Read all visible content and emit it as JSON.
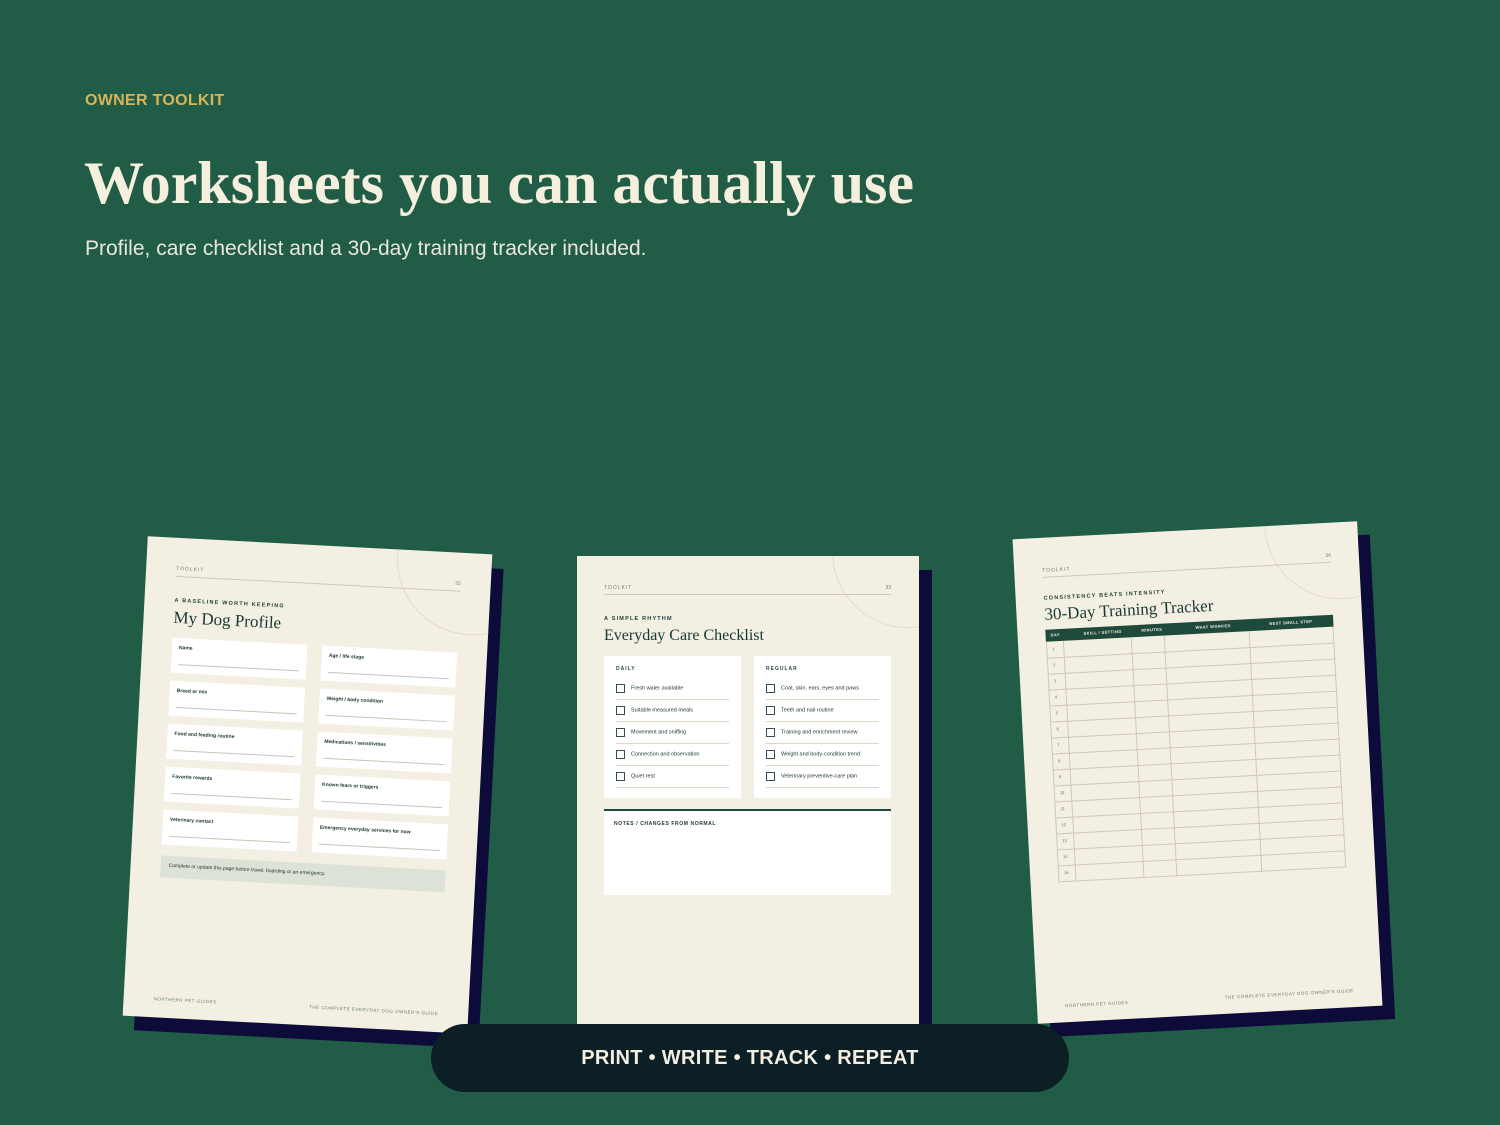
{
  "header": {
    "eyebrow": "OWNER TOOLKIT",
    "title": "Worksheets you can actually use",
    "subtitle": "Profile, care checklist and a 30-day training tracker included."
  },
  "profile_page": {
    "toolkit": "TOOLKIT",
    "page_number": "32",
    "kicker": "A BASELINE WORTH KEEPING",
    "title": "My Dog Profile",
    "fields": [
      "Name",
      "Age / life stage",
      "Breed or mix",
      "Weight / body condition",
      "Food and feeding routine",
      "Medications / sensitivities",
      "Favorite rewards",
      "Known fears or triggers",
      "Veterinary contact",
      "Emergency everyday services for now"
    ],
    "note": "Complete or update this page before travel, boarding or an emergency.",
    "footer_left": "NORTHERN PET GUIDES",
    "footer_right": "THE COMPLETE EVERYDAY DOG OWNER'S GUIDE"
  },
  "checklist_page": {
    "toolkit": "TOOLKIT",
    "page_number": "33",
    "kicker": "A SIMPLE RHYTHM",
    "title": "Everyday Care Checklist",
    "daily_label": "DAILY",
    "daily_items": [
      "Fresh water available",
      "Suitable measured meals",
      "Movement and sniffing",
      "Connection and observation",
      "Quiet rest"
    ],
    "regular_label": "REGULAR",
    "regular_items": [
      "Coat, skin, ears, eyes and paws",
      "Teeth and nail routine",
      "Training and enrichment review",
      "Weight and body-condition trend",
      "Veterinary preventive-care plan"
    ],
    "notes_label": "NOTES / CHANGES FROM NORMAL"
  },
  "tracker_page": {
    "toolkit": "TOOLKIT",
    "page_number": "34",
    "kicker": "CONSISTENCY BEATS INTENSITY",
    "title": "30-Day Training Tracker",
    "columns": [
      "DAY",
      "SKILL / SETTING",
      "MINUTES",
      "WHAT WORKED",
      "NEXT SMALL STEP"
    ],
    "rows": [
      "1",
      "2",
      "3",
      "4",
      "5",
      "6",
      "7",
      "8",
      "9",
      "10",
      "11",
      "12",
      "13",
      "14",
      "15"
    ],
    "footer_left": "NORTHERN PET GUIDES",
    "footer_right": "THE COMPLETE EVERYDAY DOG OWNER'S GUIDE"
  },
  "footer_pill": "PRINT • WRITE • TRACK • REPEAT"
}
